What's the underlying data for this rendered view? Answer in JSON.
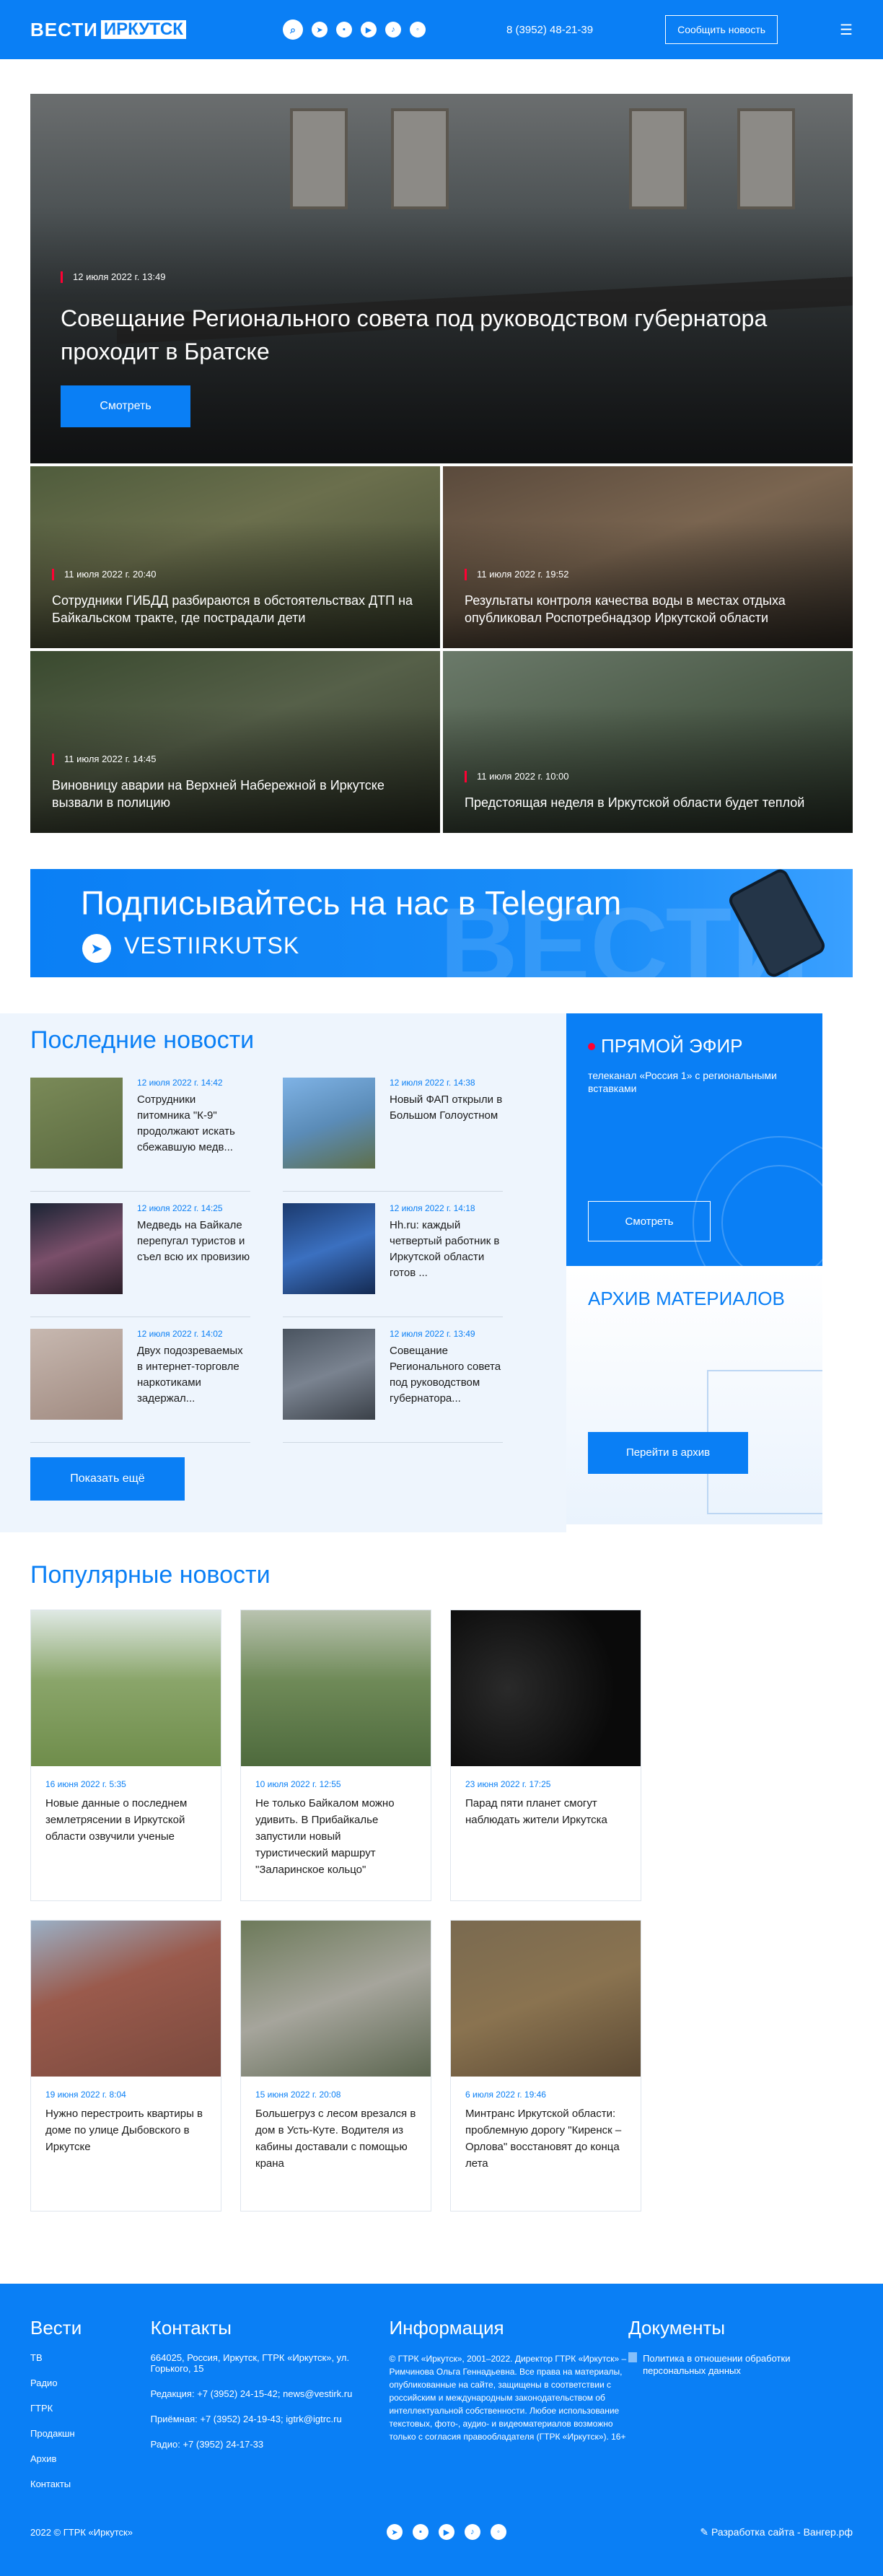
{
  "header": {
    "logo_part1": "ВЕСТИ",
    "logo_part2": "ИРКУТСК",
    "social": [
      "telegram-icon",
      "vk-icon",
      "youtube-icon",
      "tiktok-icon",
      "ok-icon"
    ],
    "phone": "8 (3952) 48-21-39",
    "report_button": "Сообщить новость"
  },
  "hero": {
    "date": "12 июля 2022 г. 13:49",
    "title": "Совещание Регионального совета под руководством губернатора проходит в Братске",
    "button": "Смотреть"
  },
  "grid_news": [
    {
      "date": "11 июля 2022 г. 20:40",
      "title": "Сотрудники ГИБДД разбираются в обстоятельствах ДТП на Байкальском тракте, где пострадали дети"
    },
    {
      "date": "11 июля 2022 г. 19:52",
      "title": "Результаты контроля качества воды в местах отдыха опубликовал Роспотребнадзор Иркутской области"
    },
    {
      "date": "11 июля 2022 г. 14:45",
      "title": "Виновницу аварии на Верхней Набережной в Иркутске вызвали в полицию"
    },
    {
      "date": "11 июля 2022 г. 10:00",
      "title": "Предстоящая неделя в Иркутской области будет теплой"
    }
  ],
  "banner": {
    "line1": "Подписывайтесь на нас в Telegram",
    "line2": "VESTIIRKUTSK",
    "bg_word": "ВЕСТИ"
  },
  "latest": {
    "title": "Последние новости",
    "items": [
      {
        "date": "12 июля 2022 г. 14:42",
        "title": "Сотрудники питомника \"К-9\" продолжают искать сбежавшую медв..."
      },
      {
        "date": "12 июля 2022 г. 14:38",
        "title": "Новый ФАП открыли в Большом Голоустном"
      },
      {
        "date": "12 июля 2022 г. 14:25",
        "title": "Медведь на Байкале перепугал туристов и съел всю их провизию"
      },
      {
        "date": "12 июля 2022 г. 14:18",
        "title": "Hh.ru: каждый четвертый работник в Иркутской области готов ..."
      },
      {
        "date": "12 июля 2022 г. 14:02",
        "title": "Двух подозреваемых в интернет-торговле наркотиками задержал..."
      },
      {
        "date": "12 июля 2022 г. 13:49",
        "title": "Совещание Регионального совета под руководством губернатора..."
      }
    ],
    "more_button": "Показать ещё"
  },
  "live": {
    "title": "ПРЯМОЙ ЭФИР",
    "subtitle": "телеканал «Россия 1» с региональными вставками",
    "button": "Смотреть"
  },
  "archive": {
    "title": "АРХИВ МАТЕРИАЛОВ",
    "button": "Перейти в архив"
  },
  "popular": {
    "title": "Популярные новости",
    "items": [
      {
        "date": "16 июня 2022 г. 5:35",
        "title": "Новые данные о последнем землетрясении в Иркутской области озвучили ученые"
      },
      {
        "date": "10 июля 2022 г. 12:55",
        "title": "Не только Байкалом можно удивить. В Прибайкалье запустили новый туристический маршрут \"Заларинское кольцо\""
      },
      {
        "date": "23 июня 2022 г. 17:25",
        "title": "Парад пяти планет смогут наблюдать жители Иркутска"
      },
      {
        "date": "19 июня 2022 г. 8:04",
        "title": "Нужно перестроить квартиры в доме по улице Дыбовского в Иркутске"
      },
      {
        "date": "15 июня 2022 г. 20:08",
        "title": "Большегруз с лесом врезался в дом в Усть-Куте. Водителя из кабины доставали с помощью крана"
      },
      {
        "date": "6 июля 2022 г. 19:46",
        "title": "Минтранс Иркутской области: проблемную дорогу \"Киренск – Орлова\" восстановят до конца лета"
      }
    ]
  },
  "footer": {
    "vesti": {
      "title": "Вести",
      "links": [
        "ТВ",
        "Радио",
        "ГТРК",
        "Продакшн",
        "Архив",
        "Контакты"
      ]
    },
    "contacts": {
      "title": "Контакты",
      "lines": [
        "664025, Россия, Иркутск, ГТРК «Иркутск», ул. Горького, 15",
        "Редакция: +7 (3952) 24-15-42; news@vestirk.ru",
        "Приёмная: +7 (3952) 24-19-43; igtrk@igtrc.ru",
        "Радио: +7 (3952) 24-17-33"
      ]
    },
    "info": {
      "title": "Информация",
      "text": "© ГТРК «Иркутск», 2001–2022. Директор ГТРК «Иркутск» – Римчинова Ольга Геннадьевна. Все права на материалы, опубликованные на сайте, защищены в соответствии с российским и международным законодательством об интеллектуальной собственности. Любое использование текстовых, фото-, аудио- и видеоматериалов возможно только с согласия правообладателя (ГТРК «Иркутск»). 16+"
    },
    "docs": {
      "title": "Документы",
      "links": [
        "Политика в отношении обработки персональных данных"
      ]
    },
    "copyright": "2022 © ГТРК «Иркутск»",
    "developer": "Разработка сайта - Вангер.рф"
  },
  "colors": {
    "accent": "#0a7ff5",
    "date_marker": "#ff0033"
  }
}
